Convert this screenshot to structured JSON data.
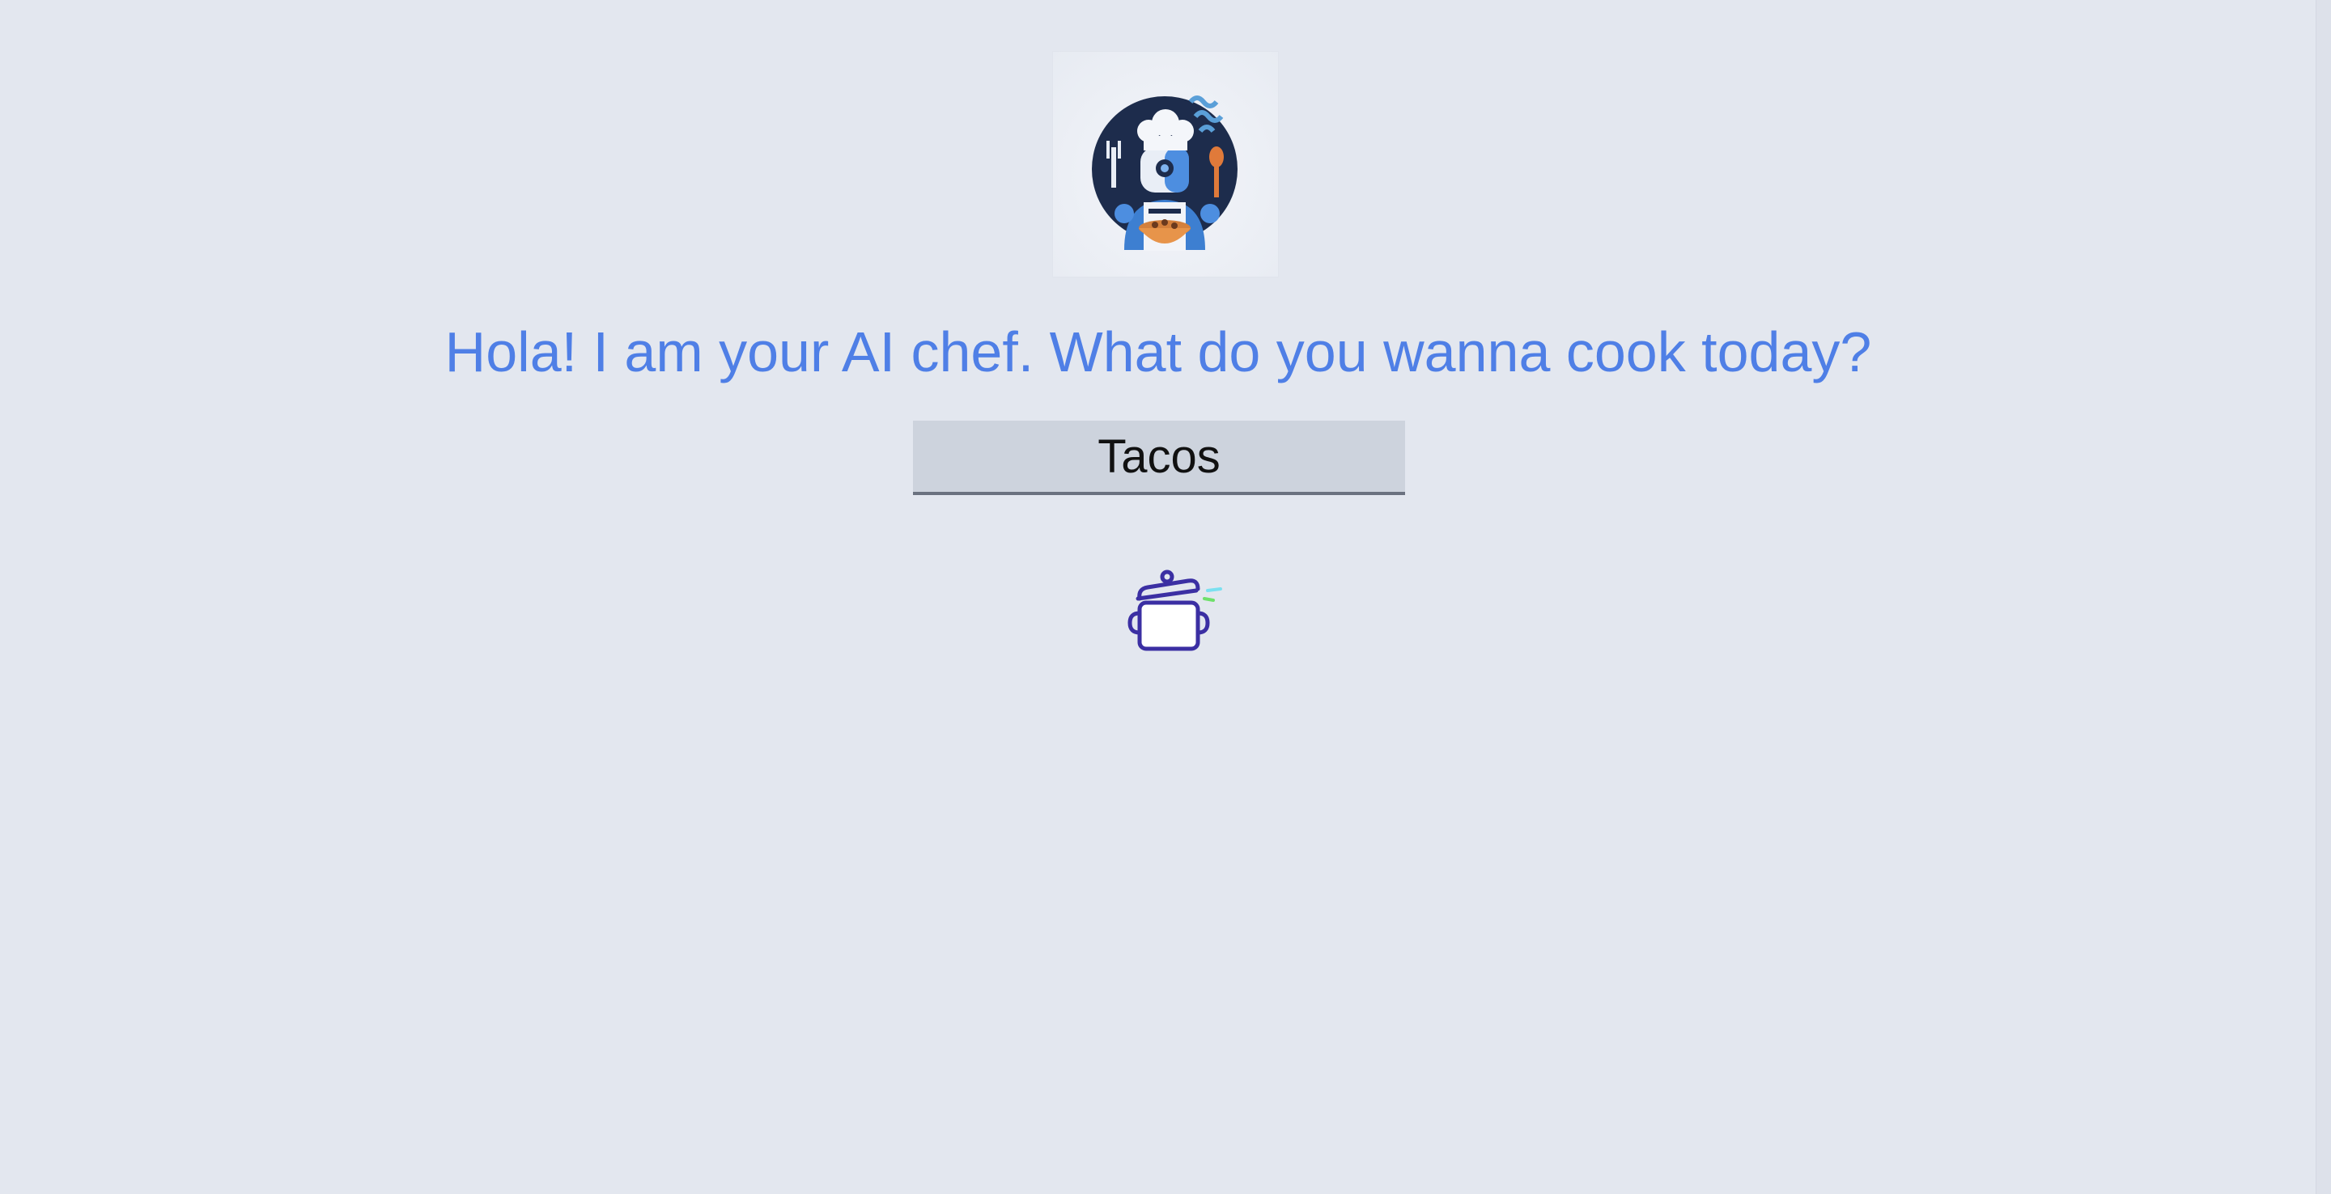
{
  "headline": "Hola! I am your AI chef. What do you wanna cook today?",
  "search": {
    "value": "Tacos"
  },
  "icons": {
    "logo": "robot-chef-logo",
    "status": "cooking-pot-icon"
  },
  "colors": {
    "background": "#e3e7ef",
    "headline": "#4f7fe6",
    "input_bg": "#cdd3dd",
    "pot_stroke": "#3b2fa3",
    "steam_a": "#7be0f0",
    "steam_b": "#6ee06a"
  }
}
